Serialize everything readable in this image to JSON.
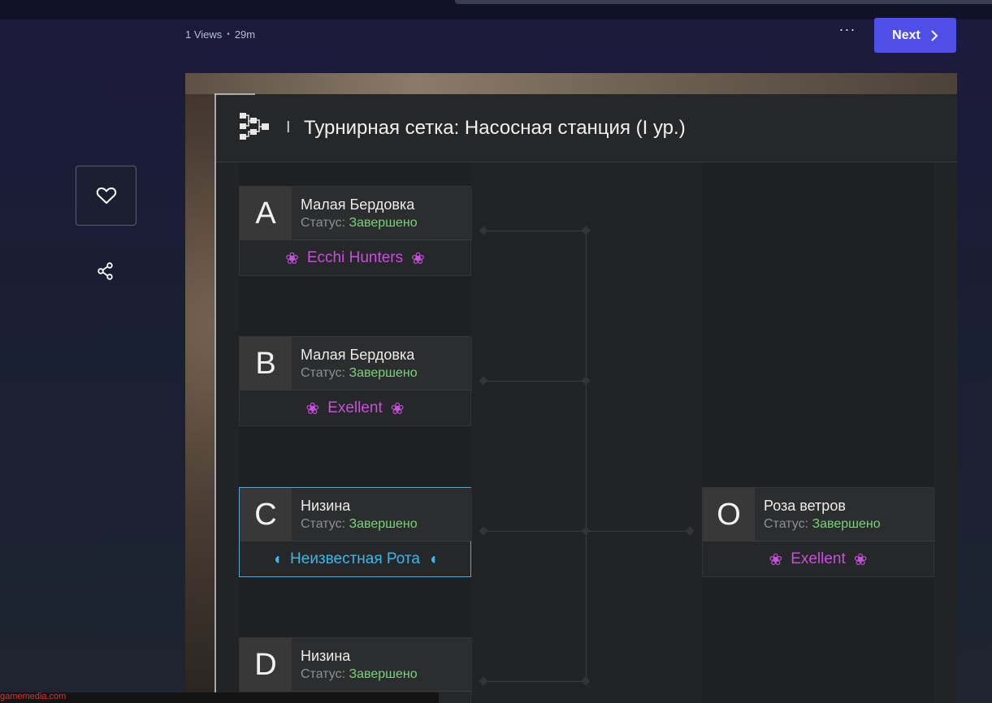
{
  "meta": {
    "views": "1 Views",
    "separator": "•",
    "age": "29m"
  },
  "toolbar": {
    "more_label": "···",
    "next_label": "Next",
    "next_icon": "chevron-right-icon"
  },
  "sidebar": {
    "like_icon": "heart-icon",
    "share_icon": "share-icon"
  },
  "footer": {
    "link_text": "gamemedia.com"
  },
  "bracket": {
    "title": "Турнирная сетка: Насосная станция (I ур.)",
    "separator": "I",
    "matches": [
      {
        "letter": "A",
        "location": "Малая Бердовка",
        "status_label": "Статус:",
        "status_value": "Завершено",
        "team": "Ecchi Hunters",
        "team_color": "#c84fe0"
      },
      {
        "letter": "B",
        "location": "Малая Бердовка",
        "status_label": "Статус:",
        "status_value": "Завершено",
        "team": "Exellent",
        "team_color": "#c84fe0"
      },
      {
        "letter": "C",
        "location": "Низина",
        "status_label": "Статус:",
        "status_value": "Завершено",
        "team": "Неизвестная Рота",
        "team_color": "#3cb8e6"
      },
      {
        "letter": "D",
        "location": "Низина",
        "status_label": "Статус:",
        "status_value": "Завершено",
        "team": "",
        "team_color": "#c84fe0"
      },
      {
        "letter": "O",
        "location": "Роза ветров",
        "status_label": "Статус:",
        "status_value": "Завершено",
        "team": "Exellent",
        "team_color": "#c84fe0"
      }
    ]
  },
  "colors": {
    "accent": "#4f4fe8",
    "status_done": "#79d27a",
    "selected_border": "#5aa6ce"
  }
}
